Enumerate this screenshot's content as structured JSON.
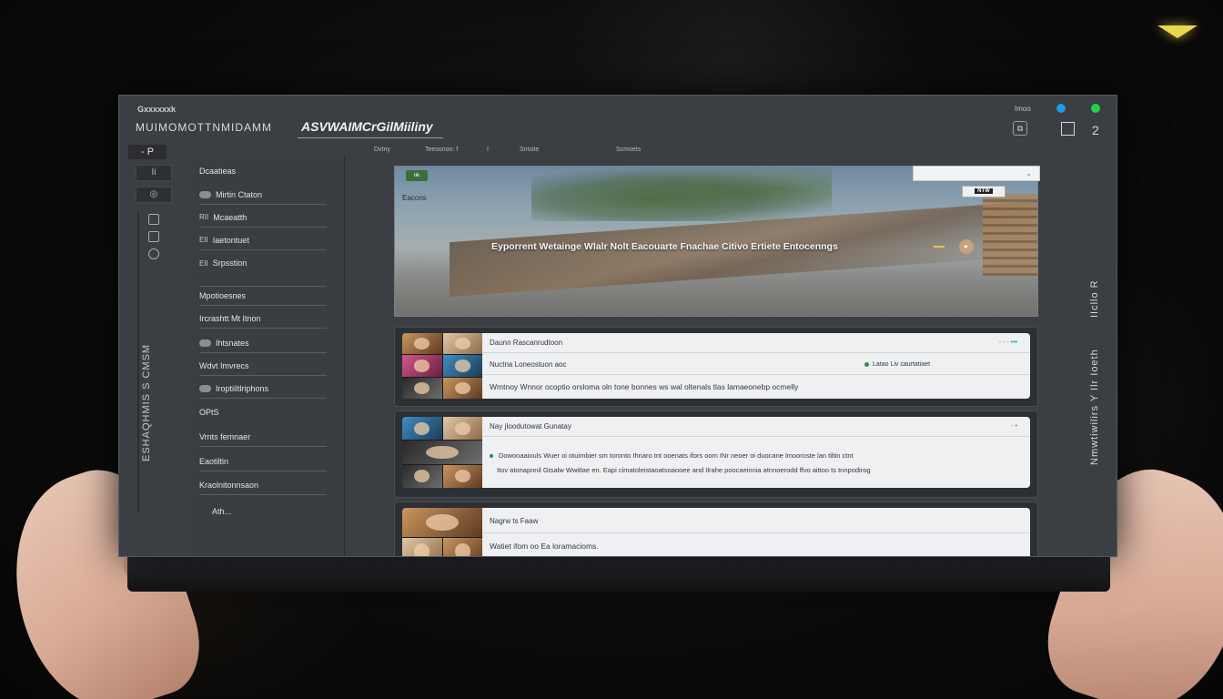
{
  "window": {
    "app_name": "Gxxxxxxk",
    "subtitle": "MUIMOMOTTNMIDAMM",
    "brand": "ASVWAIMCrGilMiiliny",
    "corner_label": "Imoo",
    "count": "2"
  },
  "rail": {
    "top_label": "- P",
    "btn1": "Ii",
    "btn2": "◎",
    "vertical_text": "ESHAQHMIS S CMSM"
  },
  "sidenav": {
    "items": [
      {
        "label": "Dcaatieas",
        "toggle": false,
        "mini": ""
      },
      {
        "label": "Mirtin Ctaton",
        "toggle": true,
        "mini": ""
      },
      {
        "label": "Mcaeatth",
        "toggle": false,
        "mini": "RII"
      },
      {
        "label": "Iaetontuet",
        "toggle": false,
        "mini": "EII"
      },
      {
        "label": "Srpsstion",
        "toggle": false,
        "mini": "EII"
      },
      {
        "label": "Mpotioesnes",
        "toggle": false,
        "mini": ""
      },
      {
        "label": "Ircrashtt Mt Itnon",
        "toggle": false,
        "mini": ""
      },
      {
        "label": "Ihtsnates",
        "toggle": true,
        "mini": ""
      },
      {
        "label": "Wdvt Imvrecs",
        "toggle": false,
        "mini": ""
      },
      {
        "label": "Iroptiiltlriphons",
        "toggle": true,
        "mini": ""
      },
      {
        "label": "OPtS",
        "toggle": false,
        "mini": ""
      },
      {
        "label": "Vrnts femnaer",
        "toggle": false,
        "mini": ""
      },
      {
        "label": "Eaotiltin",
        "toggle": false,
        "mini": ""
      },
      {
        "label": "Kraolnitonnsaon",
        "toggle": false,
        "mini": ""
      },
      {
        "label": "Ath...",
        "toggle": false,
        "mini": ""
      }
    ]
  },
  "tabs": [
    "Dvtny",
    "Teesonoo: f",
    "I",
    "Sntsite",
    "Scmoets"
  ],
  "hero": {
    "badge": "ok",
    "label": "Eacons",
    "title": "Eyporrent Wetainge Wlalr Nolt Eacouarte Fnachae Citivo Ertiete Entocenngs",
    "select_value": "",
    "chip": "NTW"
  },
  "cards": [
    {
      "header": "Daunn Rascanrudtoon",
      "header_right": "- - -",
      "sub": "Nuctna Loneostuon aoc",
      "status": "Latao Liv caurtatiaet",
      "desc": "Wmtnoy Wnnor ocoptio orsloma oln tone bonnes ws wal oltenals tlas lamaeonebp ocmelly"
    },
    {
      "header": "Nay jIoodutowat Gunatay",
      "header_right": "-  •",
      "desc1": "Dowonaaiouls Wuer oi otuimbier sm toronto Ihnaro tnt ooenats ifors oom INr neoer oi duocane lmooroste lan tiltin ctnt",
      "desc2": "Itov atonapnnil Gtsalw Wwitlae en. Eapi cimatoleistaoatsoaooee and Ilrahe poocaeinnia atnnoerodd ffvo aittoo ts tnnpodirog"
    },
    {
      "header": "Nagrw ts Faaw",
      "desc": "Watiet ifom oo Ea loramacioms."
    }
  ],
  "right_vertical": {
    "top": "IIcllo R",
    "bottom": "Nmwtiwilirs Y Ilr Ioeth"
  },
  "colors": {
    "accent_blue": "#1f9bea",
    "accent_green": "#24d04a",
    "screen_bg": "#3b3e43",
    "teal": "#1aaab0"
  }
}
